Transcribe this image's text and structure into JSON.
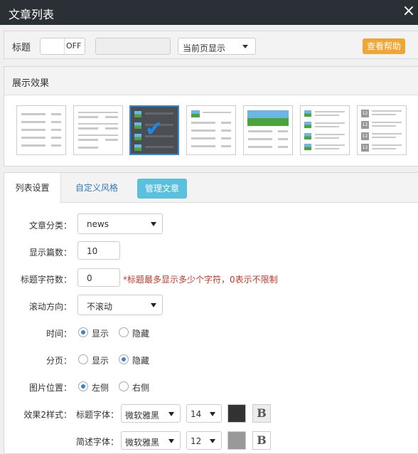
{
  "window": {
    "title": "文章列表",
    "close_glyph": "×"
  },
  "toolbar": {
    "title_label": "标题",
    "toggle_state": "OFF",
    "title_input_value": "",
    "display_select_value": "当前页显示",
    "help_label": "查看帮助",
    "help_color": "#f0a635"
  },
  "effects": {
    "header": "展示效果",
    "selected_index": 2,
    "selected_check": "✔",
    "number_badge": "12"
  },
  "tabs": {
    "list_settings": "列表设置",
    "custom_style": "自定义风格",
    "manage_articles": "管理文章"
  },
  "form": {
    "category": {
      "label": "文章分类：",
      "value": "news"
    },
    "count": {
      "label": "显示篇数：",
      "value": "10"
    },
    "title_chars": {
      "label": "标题字符数：",
      "value": "0",
      "hint": "*标题最多显示多少个字符，0表示不限制"
    },
    "scroll": {
      "label": "滚动方向：",
      "value": "不滚动"
    },
    "time": {
      "label": "时间：",
      "opt_show": "显示",
      "opt_hide": "隐藏",
      "selected": "show"
    },
    "paging": {
      "label": "分页：",
      "opt_show": "显示",
      "opt_hide": "隐藏",
      "selected": "hide"
    },
    "image_pos": {
      "label": "图片位置：",
      "opt_left": "左侧",
      "opt_right": "右侧",
      "selected": "left"
    },
    "style2": {
      "label": "效果2样式：",
      "title_font_label": "标题字体：",
      "title_font": "微软雅黑",
      "title_size": "14",
      "title_color": "#333333",
      "desc_font_label": "简述字体：",
      "desc_font": "微软雅黑",
      "desc_size": "12",
      "desc_color": "#999999",
      "bold_glyph": "B"
    }
  }
}
